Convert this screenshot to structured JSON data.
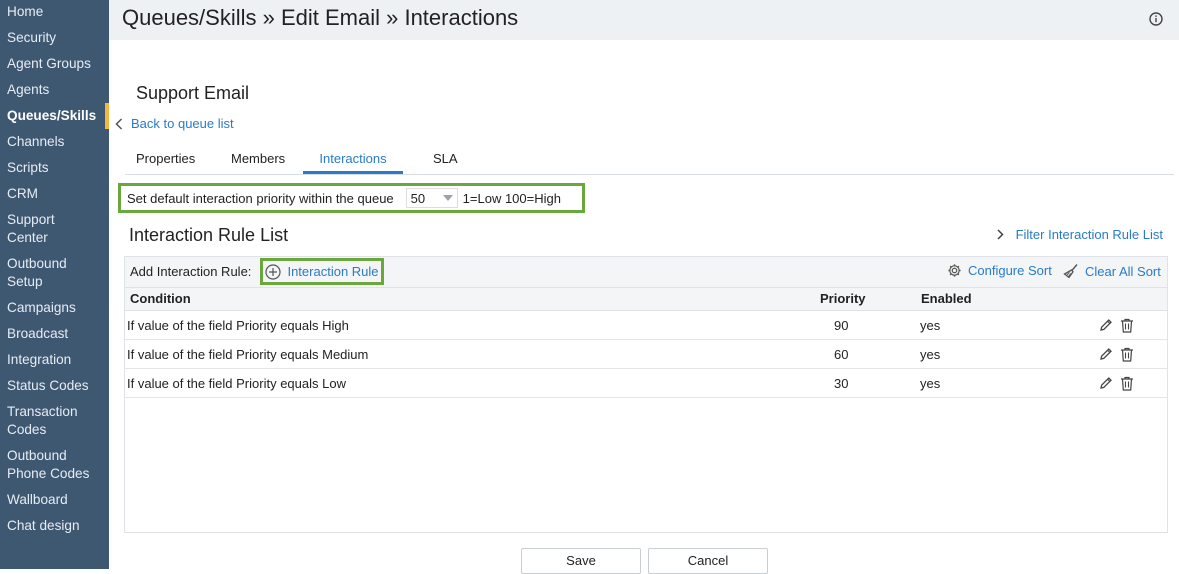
{
  "sidebar": {
    "items": [
      {
        "label": "Home"
      },
      {
        "label": "Security"
      },
      {
        "label": "Agent Groups"
      },
      {
        "label": "Agents"
      },
      {
        "label": "Queues/Skills",
        "active": true
      },
      {
        "label": "Channels"
      },
      {
        "label": "Scripts"
      },
      {
        "label": "CRM"
      },
      {
        "label": "Support Center"
      },
      {
        "label": "Outbound Setup"
      },
      {
        "label": "Campaigns"
      },
      {
        "label": "Broadcast"
      },
      {
        "label": "Integration"
      },
      {
        "label": "Status Codes"
      },
      {
        "label": "Transaction Codes"
      },
      {
        "label": "Outbound Phone Codes"
      },
      {
        "label": "Wallboard"
      },
      {
        "label": "Chat design"
      }
    ]
  },
  "header": {
    "title": "Queues/Skills » Edit Email » Interactions"
  },
  "main": {
    "queue_name": "Support Email",
    "back_label": "Back to queue list",
    "tabs": [
      {
        "label": "Properties"
      },
      {
        "label": "Members"
      },
      {
        "label": "Interactions",
        "active": true
      },
      {
        "label": "SLA"
      }
    ],
    "priority": {
      "label": "Set default interaction priority within the queue",
      "value": "50",
      "hint": "1=Low 100=High"
    },
    "list_title": "Interaction Rule List",
    "filter_label": "Filter Interaction Rule List",
    "toolbar": {
      "add_label": "Add Interaction Rule:",
      "add_button": "Interaction Rule",
      "configure_sort": "Configure Sort",
      "clear_sort": "Clear All Sort"
    },
    "table": {
      "columns": [
        "Condition",
        "Priority",
        "Enabled"
      ],
      "rows": [
        {
          "prefix": "If value of the field ",
          "field": "Priority",
          "op": " equals ",
          "value": "High",
          "priority": "90",
          "enabled": "yes"
        },
        {
          "prefix": "If value of the field ",
          "field": "Priority",
          "op": " equals ",
          "value": "Medium",
          "priority": "60",
          "enabled": "yes"
        },
        {
          "prefix": "If value of the field ",
          "field": "Priority",
          "op": " equals ",
          "value": "Low",
          "priority": "30",
          "enabled": "yes"
        }
      ]
    },
    "buttons": {
      "save": "Save",
      "cancel": "Cancel"
    }
  },
  "colors": {
    "sidebar_bg": "#3f5872",
    "active_marker": "#f4b63d",
    "link": "#2a7bc7",
    "highlight_border": "#6aa83e"
  },
  "icons": {
    "info": "info-icon",
    "back": "chevron-left-icon",
    "filter": "chevron-right-icon",
    "add": "plus-circle-icon",
    "configure": "gear-icon",
    "clear": "broom-icon",
    "edit": "pencil-icon",
    "delete": "trash-icon",
    "dropdown": "caret-down-icon"
  }
}
